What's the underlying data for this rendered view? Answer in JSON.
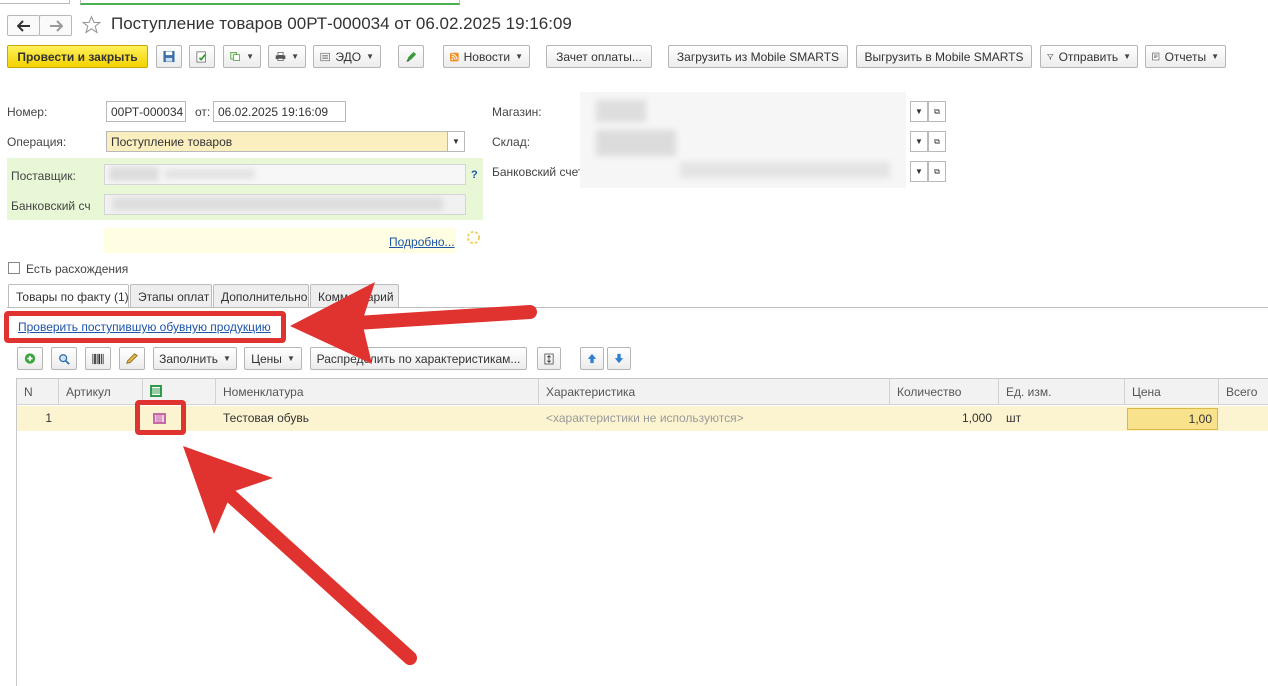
{
  "window": {
    "title": "Поступление товаров 00РТ-000034 от 06.02.2025 19:16:09"
  },
  "toolbar": {
    "post_close": "Провести и закрыть",
    "edo": "ЭДО",
    "news": "Новости",
    "payment_offset": "Зачет оплаты...",
    "load_mobile": "Загрузить из Mobile SMARTS",
    "unload_mobile": "Выгрузить в Mobile SMARTS",
    "send": "Отправить",
    "reports": "Отчеты"
  },
  "form": {
    "number_label": "Номер:",
    "number_value": "00РТ-000034",
    "date_label": "от:",
    "date_value": "06.02.2025 19:16:09",
    "operation_label": "Операция:",
    "operation_value": "Поступление товаров",
    "supplier_label": "Поставщик:",
    "bank_account_label_left": "Банковский сч",
    "help_mark": "?",
    "details_link": "Подробно...",
    "store_label": "Магазин:",
    "warehouse_label": "Склад:",
    "bank_account_label_right": "Банковский счет",
    "discrepancies_label": "Есть расхождения"
  },
  "tabs": [
    {
      "label": "Товары по факту (1)"
    },
    {
      "label": "Этапы оплат"
    },
    {
      "label": "Дополнительно"
    },
    {
      "label": "Комментарий"
    }
  ],
  "check_link": "Проверить поступившую обувную продукцию",
  "table_toolbar": {
    "fill": "Заполнить",
    "prices": "Цены",
    "distribute": "Распределить по характеристикам..."
  },
  "table": {
    "headers": {
      "n": "N",
      "article": "Артикул",
      "nomenclature": "Номенклатура",
      "characteristic": "Характеристика",
      "quantity": "Количество",
      "unit": "Ед. изм.",
      "price": "Цена",
      "total": "Всего"
    },
    "rows": [
      {
        "n": "1",
        "article": "",
        "nomenclature": "Тестовая обувь",
        "characteristic": "<характеристики не используются>",
        "quantity": "1,000",
        "unit": "шт",
        "price": "1,00",
        "total": ""
      }
    ]
  },
  "colors": {
    "primary_button": "#f3d200",
    "highlight_red": "#e0322e",
    "link": "#1d55a8",
    "supplier_area": "#e8f7d6",
    "row_highlight": "#fcf4d0"
  },
  "icons": [
    "back-arrow-icon",
    "forward-arrow-icon",
    "favorite-star-icon",
    "save-icon",
    "post-icon",
    "create-based-on-icon",
    "print-icon",
    "edo-icon",
    "edit-icon",
    "rss-icon",
    "send-icon",
    "reports-icon",
    "add-icon",
    "search-icon",
    "barcode-icon",
    "pick-icon",
    "move-up-icon",
    "move-down-icon",
    "column-marking-icon",
    "row-marking-icon"
  ]
}
